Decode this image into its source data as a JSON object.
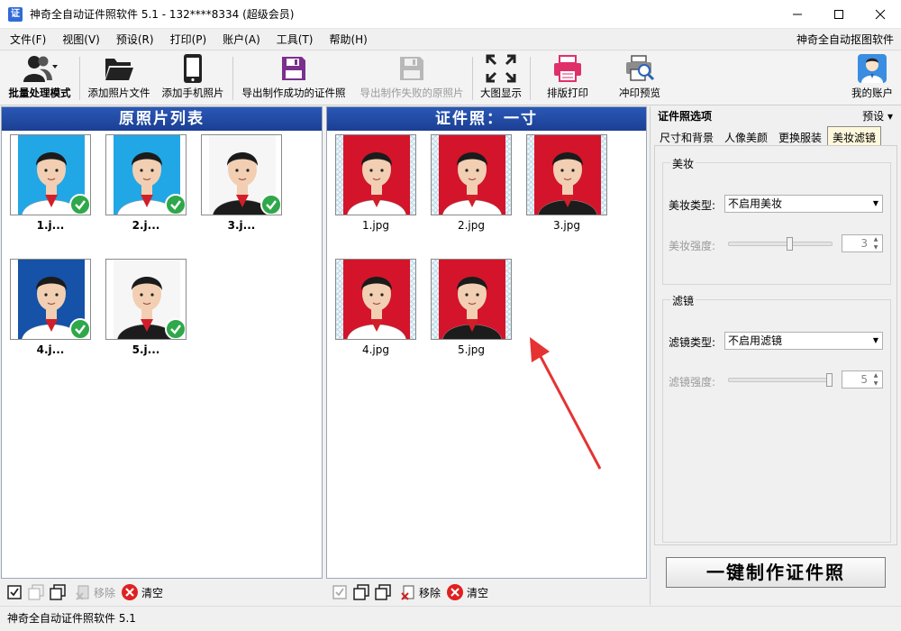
{
  "window": {
    "title": "神奇全自动证件照软件 5.1 - 132****8334 (超级会员)",
    "icon_text": "证"
  },
  "menu": {
    "items": [
      "文件(F)",
      "视图(V)",
      "预设(R)",
      "打印(P)",
      "账户(A)",
      "工具(T)",
      "帮助(H)"
    ],
    "right_link": "神奇全自动抠图软件"
  },
  "toolbar": {
    "batch_mode": "批量处理模式",
    "add_photo_file": "添加照片文件",
    "add_phone_photo": "添加手机照片",
    "export_success": "导出制作成功的证件照",
    "export_failed": "导出制作失败的原照片",
    "big_view": "大图显示",
    "layout_print": "排版打印",
    "print_preview": "冲印预览",
    "my_account": "我的账户"
  },
  "left_panel": {
    "title": "原照片列表",
    "items": [
      {
        "label": "1.j...",
        "bg": "#22a7e6",
        "shirt": "#ffffff"
      },
      {
        "label": "2.j...",
        "bg": "#22a7e6",
        "shirt": "#ffffff"
      },
      {
        "label": "3.j...",
        "bg": "#ffffff",
        "shirt": "#1c1c1c"
      },
      {
        "label": "4.j...",
        "bg": "#1552a8",
        "shirt": "#ffffff"
      },
      {
        "label": "5.j...",
        "bg": "#ffffff",
        "shirt": "#1c1c1c"
      }
    ],
    "remove": "移除",
    "clear": "清空"
  },
  "middle_panel": {
    "title": "证件照：一寸",
    "items": [
      {
        "label": "1.jpg",
        "shirt": "#ffffff"
      },
      {
        "label": "2.jpg",
        "shirt": "#ffffff"
      },
      {
        "label": "3.jpg",
        "shirt": "#1c1c1c"
      },
      {
        "label": "4.jpg",
        "shirt": "#ffffff"
      },
      {
        "label": "5.jpg",
        "shirt": "#1c1c1c"
      }
    ],
    "photo_bg": "#d4142a",
    "remove": "移除",
    "clear": "清空"
  },
  "right_panel": {
    "header": "证件照选项",
    "preset": "预设",
    "tabs": [
      "尺寸和背景",
      "人像美颜",
      "更换服装",
      "美妆滤镜"
    ],
    "active_tab": 3,
    "makeup": {
      "group_title": "美妆",
      "type_label": "美妆类型:",
      "type_value": "不启用美妆",
      "strength_label": "美妆强度:",
      "strength_value": "3",
      "strength_fraction": 0.6
    },
    "filter": {
      "group_title": "滤镜",
      "type_label": "滤镜类型:",
      "type_value": "不启用滤镜",
      "strength_label": "滤镜强度:",
      "strength_value": "5",
      "strength_fraction": 1.0
    },
    "make_button": "一键制作证件照"
  },
  "status": {
    "text": "神奇全自动证件照软件 5.1"
  },
  "colors": {
    "header_blue": "#1f4aa3",
    "check_green": "#2ea84a",
    "arrow_red": "#e53333"
  }
}
